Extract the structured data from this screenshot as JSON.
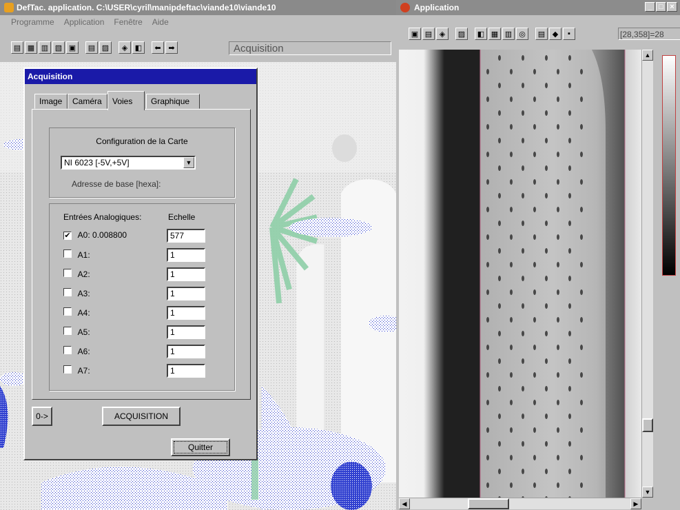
{
  "main_window": {
    "title": "DefTac. application. C:\\USER\\cyril\\manipdeftac\\viande10\\viande10",
    "menu": [
      "Programme",
      "Application",
      "Fenêtre",
      "Aide"
    ],
    "toolbar_mode": "Acquisition"
  },
  "right_window": {
    "title": "Application",
    "coords": "[28,358]=28"
  },
  "dialog": {
    "title": "Acquisition",
    "tabs": [
      "Image",
      "Caméra",
      "Voies",
      "Graphique"
    ],
    "active_tab": "Voies",
    "config_label": "Configuration de la Carte",
    "card_select": "NI 6023 [-5V,+5V]",
    "base_address_label": "Adresse de base  [hexa]:",
    "inputs_header": "Entrées Analogiques:",
    "scale_header": "Echelle",
    "channels": [
      {
        "label": "A0: 0.008800",
        "checked": true,
        "scale": "577"
      },
      {
        "label": "A1:",
        "checked": false,
        "scale": "1"
      },
      {
        "label": "A2:",
        "checked": false,
        "scale": "1"
      },
      {
        "label": "A3:",
        "checked": false,
        "scale": "1"
      },
      {
        "label": "A4:",
        "checked": false,
        "scale": "1"
      },
      {
        "label": "A5:",
        "checked": false,
        "scale": "1"
      },
      {
        "label": "A6:",
        "checked": false,
        "scale": "1"
      },
      {
        "label": "A7:",
        "checked": false,
        "scale": "1"
      }
    ],
    "zero_button": "0->",
    "acquisition_button": "ACQUISITION",
    "quit_button": "Quitter"
  },
  "colors": {
    "dialog_title_bg": "#1a1aa8",
    "stipple_blue": "#1f2fc8",
    "green_fan": "#8fcfa8"
  },
  "icons": {
    "toolbar_left": [
      "save-icon",
      "open-icon",
      "print-icon",
      "grid-icon",
      "doc-icon",
      "table-icon",
      "image-icon",
      "palette-icon",
      "chart-icon",
      "arrow-left-icon",
      "arrow-right-icon"
    ],
    "toolbar_right": [
      "app-icon",
      "app2-icon",
      "palette-icon",
      "image-icon",
      "chart-icon",
      "grid-icon",
      "layers-icon",
      "zoom-icon",
      "save-icon",
      "color-icon",
      "disk-icon"
    ]
  }
}
